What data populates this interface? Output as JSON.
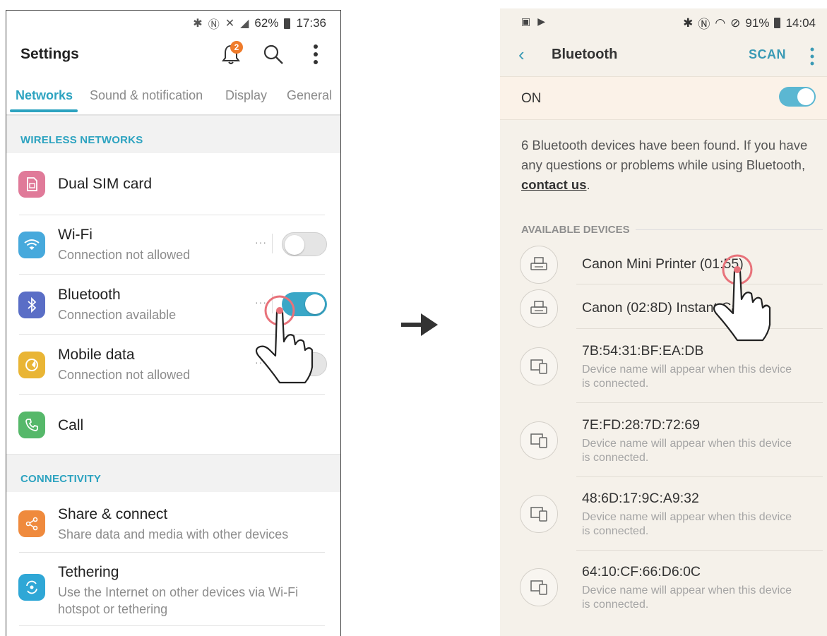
{
  "left_phone": {
    "status_bar": {
      "battery": "62%",
      "time": "17:36"
    },
    "header": {
      "title": "Settings",
      "notification_count": "2"
    },
    "tabs": [
      {
        "label": "Networks",
        "active": true
      },
      {
        "label": "Sound & notification"
      },
      {
        "label": "Display"
      },
      {
        "label": "General"
      }
    ],
    "sections": {
      "wireless": "WIRELESS NETWORKS",
      "connectivity": "CONNECTIVITY"
    },
    "rows": {
      "dual_sim": {
        "title": "Dual SIM card"
      },
      "wifi": {
        "title": "Wi-Fi",
        "subtitle": "Connection not allowed",
        "toggle": "off"
      },
      "bluetooth": {
        "title": "Bluetooth",
        "subtitle": "Connection available",
        "toggle": "on"
      },
      "mobile_data": {
        "title": "Mobile data",
        "subtitle": "Connection not allowed",
        "toggle": "off"
      },
      "call": {
        "title": "Call"
      },
      "share": {
        "title": "Share & connect",
        "subtitle": "Share data and media with other devices"
      },
      "tethering": {
        "title": "Tethering",
        "subtitle_line1": "Use the Internet on other devices via Wi-Fi",
        "subtitle_line2": "hotspot or tethering"
      }
    },
    "more_dots": "···"
  },
  "right_phone": {
    "status_bar": {
      "battery": "91%",
      "time": "14:04"
    },
    "app_bar": {
      "back": "‹",
      "title": "Bluetooth",
      "scan": "SCAN"
    },
    "master_switch": {
      "label": "ON",
      "state": "on"
    },
    "found_text": "6 Bluetooth devices have been found. If you have any questions or problems while using Bluetooth, ",
    "found_link": "contact us",
    "found_end": ".",
    "available_header": "AVAILABLE DEVICES",
    "devices": [
      {
        "name": "Canon Mini Printer (01:55)",
        "icon": "printer-icon"
      },
      {
        "name": "Canon (02:8D) Instant Camera",
        "icon": "printer-icon"
      },
      {
        "name": "7B:54:31:BF:EA:DB",
        "sub_line1": "Device name will appear when this device",
        "sub_line2": "is connected.",
        "icon": "devices-icon"
      },
      {
        "name": "7E:FD:28:7D:72:69",
        "sub_line1": "Device name will appear when this device",
        "sub_line2": "is connected.",
        "icon": "devices-icon"
      },
      {
        "name": "48:6D:17:9C:A9:32",
        "sub_line1": "Device name will appear when this device",
        "sub_line2": "is connected.",
        "icon": "devices-icon"
      },
      {
        "name": "64:10:CF:66:D6:0C",
        "sub_line1": "Device name will appear when this device",
        "sub_line2": "is connected.",
        "icon": "devices-icon"
      }
    ]
  },
  "colors": {
    "accent": "#2da3c0",
    "badge": "#ef7b2a",
    "touch_ring": "#e8727a"
  }
}
